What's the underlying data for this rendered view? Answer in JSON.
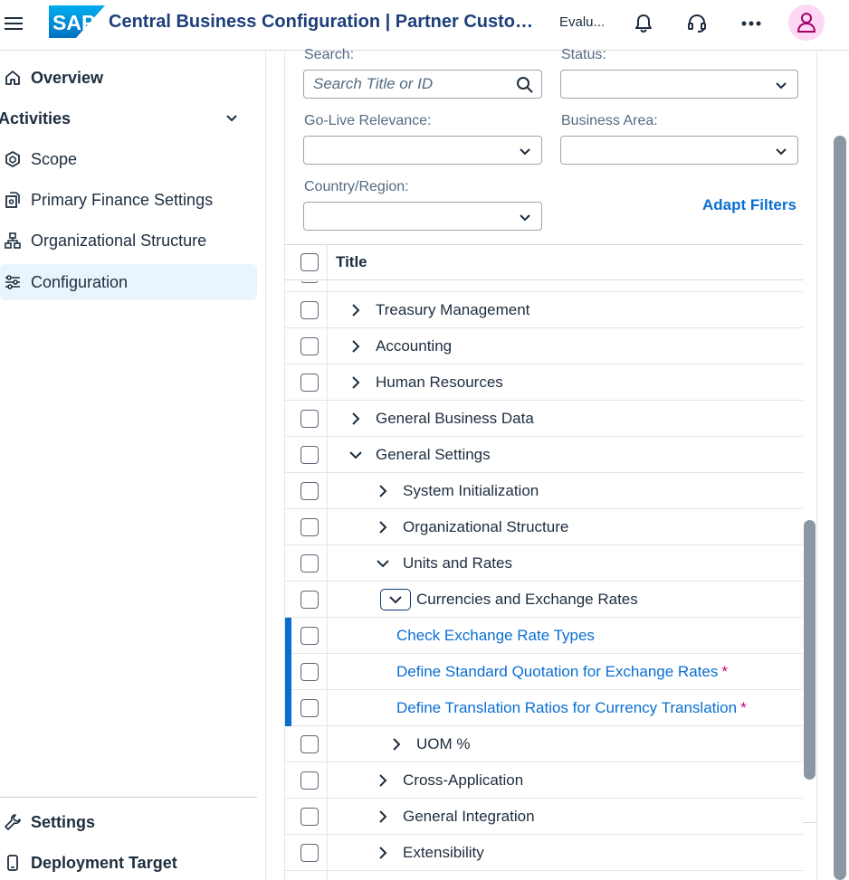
{
  "shell": {
    "logo_text": "SAP",
    "title": "Central Business Configuration | Partner Custom...",
    "evaluation_label": "Evalu..."
  },
  "sidenav": {
    "items": [
      {
        "label": "Overview",
        "icon": "home-icon"
      },
      {
        "label": "Activities",
        "icon": "chevron-down-icon"
      },
      {
        "label": "Scope",
        "icon": "cube-icon"
      },
      {
        "label": "Primary Finance Settings",
        "icon": "finance-settings-icon"
      },
      {
        "label": "Organizational Structure",
        "icon": "org-chart-icon"
      },
      {
        "label": "Configuration",
        "icon": "sliders-icon"
      }
    ],
    "footer": [
      {
        "label": "Settings",
        "icon": "wrench-icon"
      },
      {
        "label": "Deployment Target",
        "icon": "device-icon"
      }
    ]
  },
  "filters": {
    "search_label": "Search:",
    "search_placeholder": "Search Title or ID",
    "status_label": "Status:",
    "go_live_label": "Go-Live Relevance:",
    "business_area_label": "Business Area:",
    "country_label": "Country/Region:",
    "adapt_filters": "Adapt Filters"
  },
  "table": {
    "header_title": "Title",
    "rows": [
      {
        "label": "Treasury Management",
        "level": 1,
        "state": "collapsed",
        "link": false
      },
      {
        "label": "Accounting",
        "level": 1,
        "state": "collapsed",
        "link": false
      },
      {
        "label": "Human Resources",
        "level": 1,
        "state": "collapsed",
        "link": false
      },
      {
        "label": "General Business Data",
        "level": 1,
        "state": "collapsed",
        "link": false
      },
      {
        "label": "General Settings",
        "level": 1,
        "state": "expanded",
        "link": false
      },
      {
        "label": "System Initialization",
        "level": 2,
        "state": "collapsed",
        "link": false
      },
      {
        "label": "Organizational Structure",
        "level": 2,
        "state": "collapsed",
        "link": false
      },
      {
        "label": "Units and Rates",
        "level": 2,
        "state": "expanded",
        "link": false
      },
      {
        "label": "Currencies and Exchange Rates",
        "level": 3,
        "state": "expanded-focused",
        "link": false
      },
      {
        "label": "Check Exchange Rate Types",
        "level": 4,
        "state": "leaf",
        "link": true,
        "required": false
      },
      {
        "label": "Define Standard Quotation for Exchange Rates",
        "level": 4,
        "state": "leaf",
        "link": true,
        "required": true
      },
      {
        "label": "Define Translation Ratios for Currency Translation",
        "level": 4,
        "state": "leaf",
        "link": true,
        "required": true
      },
      {
        "label": "UOM %",
        "level": 3,
        "state": "collapsed",
        "link": false
      },
      {
        "label": "Cross-Application",
        "level": 2,
        "state": "collapsed",
        "link": false
      },
      {
        "label": "General Integration",
        "level": 2,
        "state": "collapsed",
        "link": false
      },
      {
        "label": "Extensibility",
        "level": 2,
        "state": "collapsed",
        "link": false
      }
    ],
    "required_marker": "*"
  },
  "colors": {
    "accent": "#0a6ed1",
    "title": "#1d3f7a",
    "required": "#d0006f",
    "avatar_bg": "#fdd8f4",
    "selected_nav": "#eaf4fd"
  }
}
